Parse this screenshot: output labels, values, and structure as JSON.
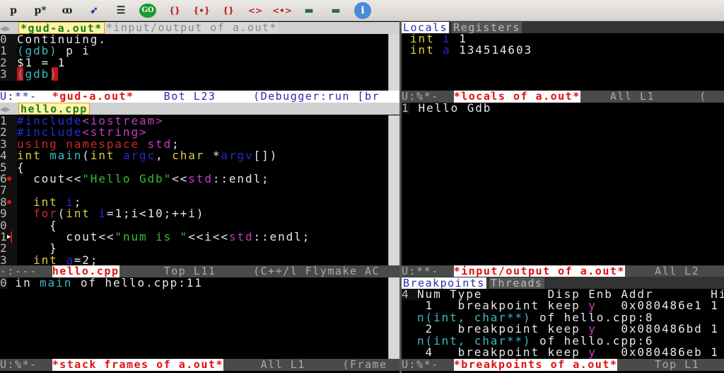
{
  "toolbar": {
    "items": [
      {
        "icon": "print-icon",
        "label": "p"
      },
      {
        "icon": "print-deref-icon",
        "label": "p*"
      },
      {
        "icon": "watch-icon",
        "label": "ꝏ"
      },
      {
        "icon": "run-icon",
        "label": "➶"
      },
      {
        "icon": "remove-breakpoint-icon",
        "label": "☰"
      },
      {
        "icon": "go-icon",
        "label": "GO"
      },
      {
        "icon": "next-icon",
        "label": "{}"
      },
      {
        "icon": "step-icon",
        "label": "{•}"
      },
      {
        "icon": "finish-icon",
        "label": "{}"
      },
      {
        "icon": "nexti-icon",
        "label": "<>"
      },
      {
        "icon": "stepi-icon",
        "label": "<•>"
      },
      {
        "icon": "up-stack-icon",
        "label": "▬"
      },
      {
        "icon": "down-stack-icon",
        "label": "▬"
      },
      {
        "icon": "info-icon",
        "label": "i"
      }
    ]
  },
  "gud": {
    "tabs": [
      "*gud-a.out*",
      "*input/output of a.out*"
    ],
    "lines": [
      {
        "n": "0",
        "segs": [
          [
            "Continuing.",
            "pl"
          ]
        ]
      },
      {
        "n": "1",
        "segs": [
          [
            "(gdb) ",
            "cy"
          ],
          [
            "p i",
            "pl"
          ]
        ]
      },
      {
        "n": "2",
        "segs": [
          [
            "$1 = 1",
            "pl"
          ]
        ]
      },
      {
        "n": "3",
        "segs": [
          [
            "(gdb)",
            "cy"
          ]
        ]
      }
    ],
    "modeline": {
      "status": "U:**-  ",
      "buffer": "*gud-a.out*",
      "pos": "    Bot L23     ",
      "mode": "(Debugger:run [br"
    }
  },
  "source": {
    "tab": "hello.cpp",
    "lines": [
      {
        "n": "1",
        "segs": [
          [
            "#include",
            "pp"
          ],
          [
            "<iostream>",
            "inc"
          ]
        ]
      },
      {
        "n": "2",
        "segs": [
          [
            "#include",
            "pp"
          ],
          [
            "<string>",
            "inc"
          ]
        ]
      },
      {
        "n": "3",
        "segs": [
          [
            "using namespace ",
            "kw"
          ],
          [
            "std",
            "ns"
          ],
          [
            ";",
            "pl"
          ]
        ]
      },
      {
        "n": "4",
        "segs": [
          [
            "int ",
            "ty"
          ],
          [
            "main",
            "fn"
          ],
          [
            "(",
            "pl"
          ],
          [
            "int ",
            "ty"
          ],
          [
            "argc",
            "var"
          ],
          [
            ", ",
            "pl"
          ],
          [
            "char ",
            "ty"
          ],
          [
            "*",
            "pl"
          ],
          [
            "argv",
            "var"
          ],
          [
            "[])",
            "pl"
          ]
        ]
      },
      {
        "n": "5",
        "segs": [
          [
            "{",
            "pl"
          ]
        ]
      },
      {
        "n": "6",
        "bp": true,
        "segs": [
          [
            "  cout<<",
            "pl"
          ],
          [
            "\"Hello Gdb\"",
            "str"
          ],
          [
            "<<",
            "pl"
          ],
          [
            "std",
            "ns"
          ],
          [
            "::endl;",
            "pl"
          ]
        ]
      },
      {
        "n": "7",
        "segs": []
      },
      {
        "n": "8",
        "bp": true,
        "segs": [
          [
            "  int ",
            "ty"
          ],
          [
            "i",
            "var"
          ],
          [
            ";",
            "pl"
          ]
        ]
      },
      {
        "n": "9",
        "segs": [
          [
            "  for",
            "kw"
          ],
          [
            "(",
            "pl"
          ],
          [
            "int ",
            "ty"
          ],
          [
            "i",
            "var"
          ],
          [
            "=1;i<10;++i)",
            "pl"
          ]
        ]
      },
      {
        "n": "0",
        "segs": [
          [
            "    {",
            "pl"
          ]
        ]
      },
      {
        "n": "1",
        "arrow": true,
        "segs": [
          [
            "      cout<<",
            "pl"
          ],
          [
            "\"num is \"",
            "str"
          ],
          [
            "<<i<<",
            "pl"
          ],
          [
            "std",
            "ns"
          ],
          [
            "::endl;",
            "pl"
          ]
        ]
      },
      {
        "n": "2",
        "segs": [
          [
            "    }",
            "pl"
          ]
        ]
      },
      {
        "n": "3",
        "segs": [
          [
            "  int ",
            "ty"
          ],
          [
            "a",
            "var"
          ],
          [
            "=2;",
            "pl"
          ]
        ]
      }
    ],
    "modeline": {
      "status": "-:---  ",
      "buffer": "hello.cpp",
      "pos": "      Top L11     ",
      "mode": "(C++/l Flymake AC"
    }
  },
  "stack": {
    "line": {
      "n": "0",
      "segs": [
        [
          " in ",
          "pl"
        ],
        [
          "main",
          "cy"
        ],
        [
          " of hello.cpp:11",
          "pl"
        ]
      ]
    },
    "modeline": {
      "status": "U:%*-  ",
      "buffer": "*stack frames of a.out*",
      "pos": "     All L1     ",
      "mode": "(Frame"
    }
  },
  "locals": {
    "tabs": [
      "Locals",
      "Registers"
    ],
    "lines": [
      {
        "segs": [
          [
            "int ",
            "ty"
          ],
          [
            "i ",
            "var"
          ],
          [
            "1",
            "pl"
          ]
        ]
      },
      {
        "segs": [
          [
            "int ",
            "ty"
          ],
          [
            "a ",
            "var"
          ],
          [
            "134514603",
            "pl"
          ]
        ]
      }
    ],
    "modeline": {
      "status": "U:%*-  ",
      "buffer": "*locals of a.out*",
      "pos": "    All L1      ",
      "mode": "("
    }
  },
  "io": {
    "lines": [
      {
        "n": "1",
        "segs": [
          [
            " Hello Gdb",
            "pl"
          ]
        ]
      }
    ],
    "modeline": {
      "status": "U:**-  ",
      "buffer": "*input/output of a.out*",
      "pos": "    All L2",
      "mode": ""
    }
  },
  "breakpoints": {
    "tabs": [
      "Breakpoints",
      "Threads"
    ],
    "lines": [
      {
        "n": "4",
        "segs": [
          [
            "Num Type        Disp Enb Addr       Hit",
            "pl"
          ]
        ]
      },
      {
        "segs": [
          [
            " 1   breakpoint keep ",
            "pl"
          ],
          [
            "y",
            "ns"
          ],
          [
            "   0x080486e1 1",
            "pl"
          ]
        ]
      },
      {
        "segs": [
          [
            "n(int, char**)",
            "cy"
          ],
          [
            " of hello.cpp:8",
            "pl"
          ]
        ]
      },
      {
        "segs": [
          [
            " 2   breakpoint keep ",
            "pl"
          ],
          [
            "y",
            "ns"
          ],
          [
            "   0x080486bd 1",
            "pl"
          ]
        ]
      },
      {
        "segs": [
          [
            "n(int, char**)",
            "cy"
          ],
          [
            " of hello.cpp:6",
            "pl"
          ]
        ]
      },
      {
        "segs": [
          [
            " 4   breakpoint keep ",
            "pl"
          ],
          [
            "y",
            "ns"
          ],
          [
            "   0x080486eb 1",
            "pl"
          ]
        ]
      }
    ],
    "modeline": {
      "status": "U:%*-  ",
      "buffer": "*breakpoints of a.out*",
      "pos": "     Top L1",
      "mode": ""
    }
  },
  "colors": {
    "accent": "#d02828",
    "modeline": "#4a4a4a",
    "tab_selected": "#fff3a8"
  }
}
